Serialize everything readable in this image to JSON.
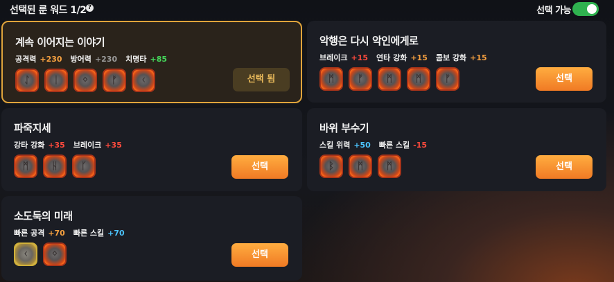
{
  "header": {
    "title": "선택된 룬 워드 1/2",
    "help_icon": "?",
    "toggle_label": "선택 가능",
    "toggle_on": true,
    "toggle_color": "#2fb24f"
  },
  "cards": [
    {
      "title": "계속 이어지는 이야기",
      "selected": true,
      "stats": [
        {
          "label": "공격력",
          "value": "+230",
          "color": "orange"
        },
        {
          "label": "방어력",
          "value": "+230",
          "color": "gray"
        },
        {
          "label": "치명타",
          "value": "+85",
          "color": "green"
        }
      ],
      "runes": [
        "ᛇ",
        "ᛁ",
        "ᛜ",
        "ᚠ",
        "ᚲ"
      ],
      "button": "선택 됨"
    },
    {
      "title": "악행은 다시 악인에게로",
      "selected": false,
      "stats": [
        {
          "label": "브레이크",
          "value": "+15",
          "color": "red"
        },
        {
          "label": "연타 강화",
          "value": "+15",
          "color": "orange"
        },
        {
          "label": "콤보 강화",
          "value": "+15",
          "color": "orange"
        }
      ],
      "runes": [
        "ᛗ",
        "ᚠ",
        "ᛗ",
        "ᛗ",
        "ᚠ"
      ],
      "button": "선택"
    },
    {
      "title": "파죽지세",
      "selected": false,
      "stats": [
        {
          "label": "강타 강화",
          "value": "+35",
          "color": "red"
        },
        {
          "label": "브레이크",
          "value": "+35",
          "color": "red"
        }
      ],
      "runes": [
        "ᛗ",
        "ᚺ",
        "ᚴ"
      ],
      "button": "선택"
    },
    {
      "title": "바위 부수기",
      "selected": false,
      "stats": [
        {
          "label": "스킬 위력",
          "value": "+50",
          "color": "blue"
        },
        {
          "label": "빠른 스킬",
          "value": "-15",
          "color": "red"
        }
      ],
      "runes": [
        "ᛒ",
        "ᛗ",
        "ᛗ"
      ],
      "button": "선택"
    },
    {
      "title": "소도둑의 미래",
      "selected": false,
      "stats": [
        {
          "label": "빠른 공격",
          "value": "+70",
          "color": "orange"
        },
        {
          "label": "빠른 스킬",
          "value": "+70",
          "color": "blue"
        }
      ],
      "runes": [
        "ᚲ",
        "ᛜ"
      ],
      "gold_runes": [
        0
      ],
      "button": "선택"
    }
  ]
}
